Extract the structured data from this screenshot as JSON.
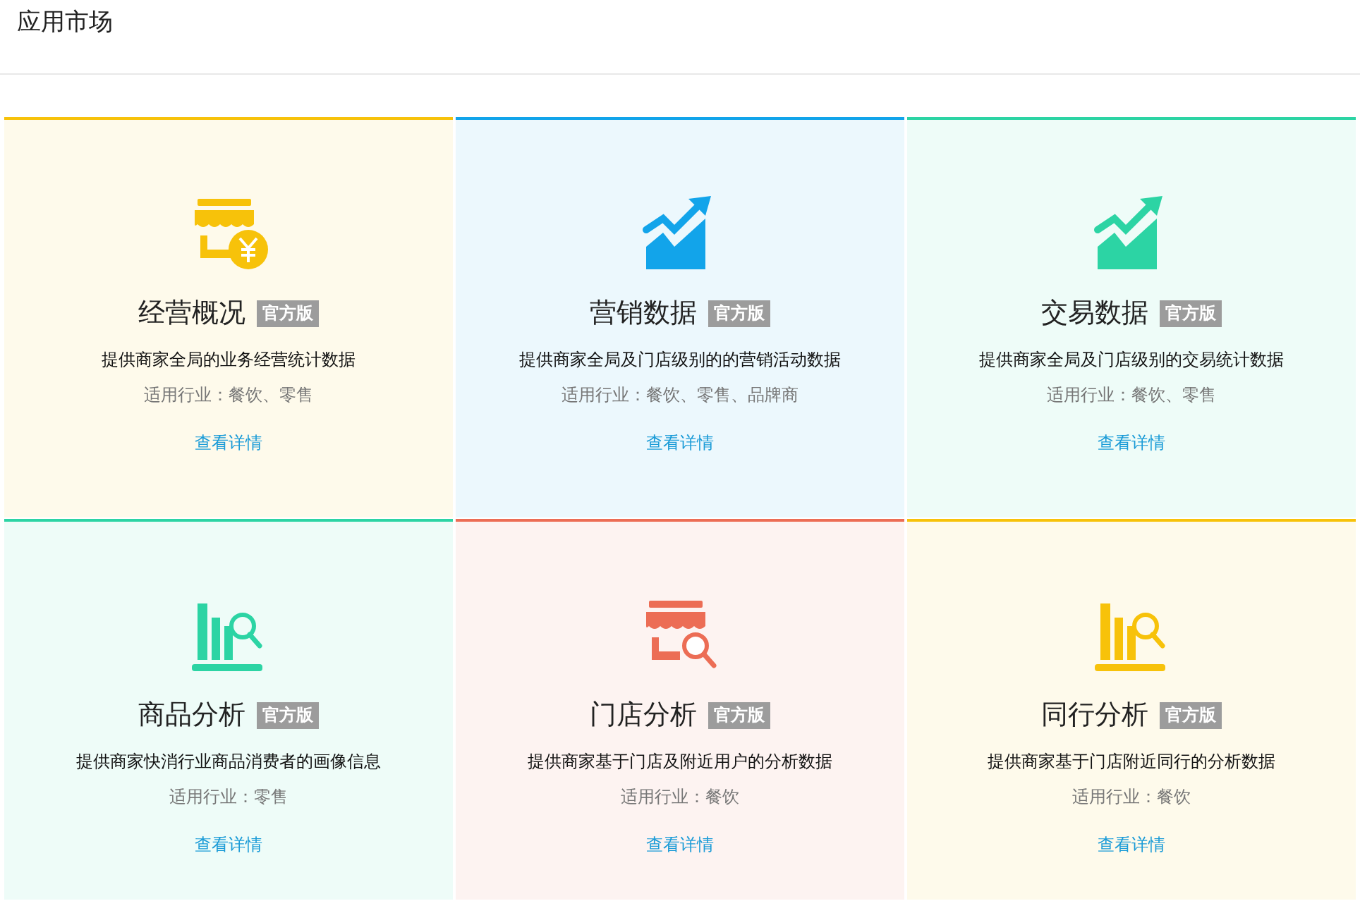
{
  "page": {
    "title": "应用市场"
  },
  "apps": [
    {
      "kind": "shop-coin",
      "color": "#f7c20a",
      "name": "经营概况",
      "badge": "官方版",
      "description": "提供商家全局的业务经营统计数据",
      "industries": "适用行业：餐饮、零售",
      "link": "查看详情"
    },
    {
      "kind": "trend",
      "color": "#12a4ea",
      "name": "营销数据",
      "badge": "官方版",
      "description": "提供商家全局及门店级别的的营销活动数据",
      "industries": "适用行业：餐饮、零售、品牌商",
      "link": "查看详情"
    },
    {
      "kind": "trend",
      "color": "#2cd4a4",
      "name": "交易数据",
      "badge": "官方版",
      "description": "提供商家全局及门店级别的交易统计数据",
      "industries": "适用行业：餐饮、零售",
      "link": "查看详情"
    },
    {
      "kind": "shelf-search",
      "color": "#2cd4a4",
      "name": "商品分析",
      "badge": "官方版",
      "description": "提供商家快消行业商品消费者的画像信息",
      "industries": "适用行业：零售",
      "link": "查看详情"
    },
    {
      "kind": "shop-search",
      "color": "#ec6d55",
      "name": "门店分析",
      "badge": "官方版",
      "description": "提供商家基于门店及附近用户的分析数据",
      "industries": "适用行业：餐饮",
      "link": "查看详情"
    },
    {
      "kind": "shelf-search",
      "color": "#f7c20a",
      "name": "同行分析",
      "badge": "官方版",
      "description": "提供商家基于门店附近同行的分析数据",
      "industries": "适用行业：餐饮",
      "link": "查看详情"
    }
  ]
}
